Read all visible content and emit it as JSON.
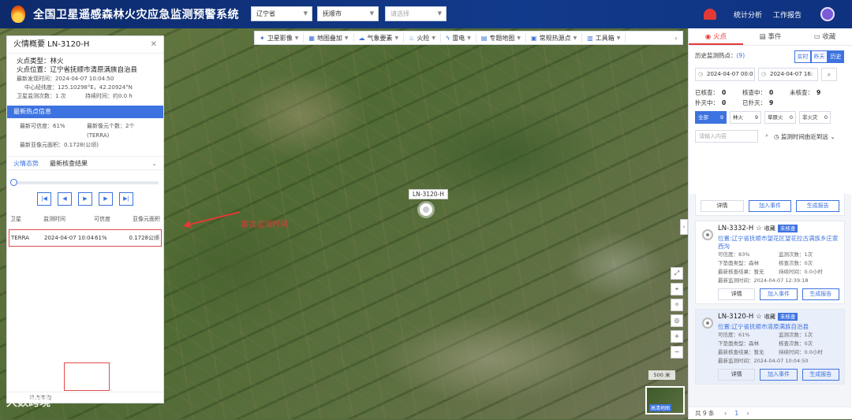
{
  "header": {
    "title": "全国卫星遥感森林火灾应急监测预警系统",
    "province": "辽宁省",
    "city": "抚顺市",
    "district_placeholder": "请选择",
    "stats_link": "统计分析",
    "report_link": "工作报告"
  },
  "toolbar": {
    "items": [
      "卫星影像",
      "地图叠加",
      "气象要素",
      "火险",
      "雷电",
      "专题地图",
      "常规热源点",
      "工具箱"
    ]
  },
  "map": {
    "fire_label": "LN-3120-H",
    "annotation": "首次监测时间",
    "scale": "500 米",
    "minimap_label": "高清地图"
  },
  "left_panel": {
    "title": "火情概要 LN-3120-H",
    "fire_type_label": "火点类型：",
    "fire_type": "林火",
    "location_label": "火点位置：",
    "location": "辽宁省抚顺市清原满族自治县",
    "latest_time_label": "最新发现时间：",
    "latest_time": "2024-04-07 10:04:50",
    "center_label": "中心经纬度：",
    "center": "125.10298°E，42.20924°N",
    "monitor_count_label": "卫星监测次数：",
    "monitor_count": "1 次",
    "duration_label": "持续时间：",
    "duration": "约0.0 h",
    "hotspot_bar": "最新热点信息",
    "confidence_label": "最新可信度：",
    "confidence": "61%",
    "pixel_count_label": "最新像元个数：",
    "pixel_count": "2个(TERRA)",
    "pixel_area_label": "最新亚像元面积：",
    "pixel_area": "0.1728(公顷)",
    "tab1": "火情态势",
    "tab2": "最新核查结果",
    "table_headers": [
      "卫星",
      "监测时间",
      "可信度",
      "亚像元面积"
    ],
    "table_row": [
      "TERRA",
      "2024-04-07 10:04",
      "61%",
      "0.1728公顷"
    ],
    "bottom_text": "格点查询"
  },
  "watermark": "大数跨境",
  "right_panel": {
    "tabs": [
      "火点",
      "事件",
      "收藏"
    ],
    "history_label": "历史监测热点：",
    "history_count": "(9)",
    "toggles": [
      "实时",
      "昨天",
      "历史"
    ],
    "date_from": "2024-04-07 00:0",
    "date_to": "2024-04-07 16:",
    "stats": [
      [
        "已核查：",
        "0",
        "核查中：",
        "0",
        "未核查：",
        "9"
      ],
      [
        "扑灭中：",
        "0",
        "已扑灭：",
        "9"
      ]
    ],
    "filters": [
      [
        "全部",
        "9"
      ],
      [
        "林火",
        "9"
      ],
      [
        "草原火",
        "0"
      ],
      [
        "非火灾",
        "0"
      ]
    ],
    "search_placeholder": "请输入内容",
    "sort_label": "监测时间由近到远",
    "cards": [
      {
        "buttons": [
          "详情",
          "加入事件",
          "生成报告"
        ]
      },
      {
        "id": "LN-3332-H",
        "fav": "收藏",
        "badge": "未核查",
        "position": "位置:辽宁省抚顺市望花区望花拉古满族乡庄家西沟",
        "rows": [
          [
            "可信度：",
            "83%",
            "监测次数：",
            "1次"
          ],
          [
            "下垫面类型：",
            "森林",
            "核查次数：",
            "0次"
          ],
          [
            "最新核查结果：",
            "暂无",
            "持续时间：",
            "0.0小时"
          ]
        ],
        "time_label": "最新监测时间：",
        "time": "2024-04-07 12:39:18",
        "buttons": [
          "详情",
          "加入事件",
          "生成报告"
        ]
      },
      {
        "id": "LN-3120-H",
        "fav": "收藏",
        "badge": "未核查",
        "position": "位置:辽宁省抚顺市清原满族自治县",
        "rows": [
          [
            "可信度：",
            "61%",
            "监测次数：",
            "1次"
          ],
          [
            "下垫面类型：",
            "森林",
            "核查次数：",
            "0次"
          ],
          [
            "最新核查结果：",
            "暂无",
            "持续时间：",
            "0.0小时"
          ]
        ],
        "time_label": "最新监测时间：",
        "time": "2024-04-07 10:04:50",
        "buttons": [
          "详情",
          "加入事件",
          "生成报告"
        ]
      }
    ],
    "pager_total": "共 9 条",
    "pager_page": "1"
  }
}
